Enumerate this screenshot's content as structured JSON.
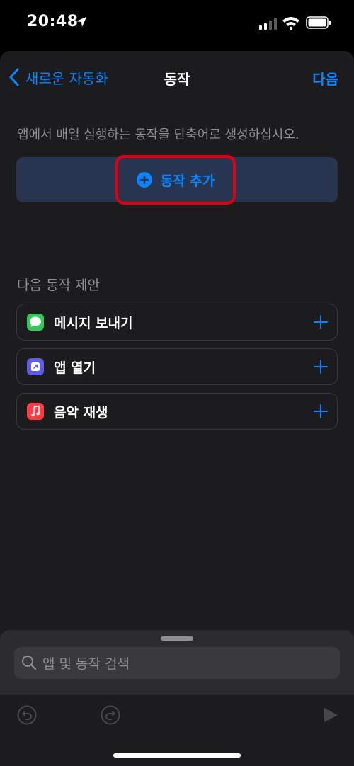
{
  "status": {
    "time": "20:48"
  },
  "nav": {
    "back_label": "새로운 자동화",
    "title": "동작",
    "next_label": "다음"
  },
  "description": "앱에서 매일 실행하는 동작을 단축어로 생성하십시오.",
  "add_action_label": "동작 추가",
  "suggestions": {
    "header": "다음 동작 제안",
    "items": [
      {
        "label": "메시지 보내기",
        "icon": "messages-icon",
        "color": "#34c759"
      },
      {
        "label": "앱 열기",
        "icon": "open-app-icon",
        "color": "#5e5ce6"
      },
      {
        "label": "음악 재생",
        "icon": "music-icon",
        "color": "#fc3c44"
      }
    ]
  },
  "search": {
    "placeholder": "앱 및 동작 검색"
  },
  "colors": {
    "accent": "#0a84ff",
    "highlight": "#e10010"
  }
}
